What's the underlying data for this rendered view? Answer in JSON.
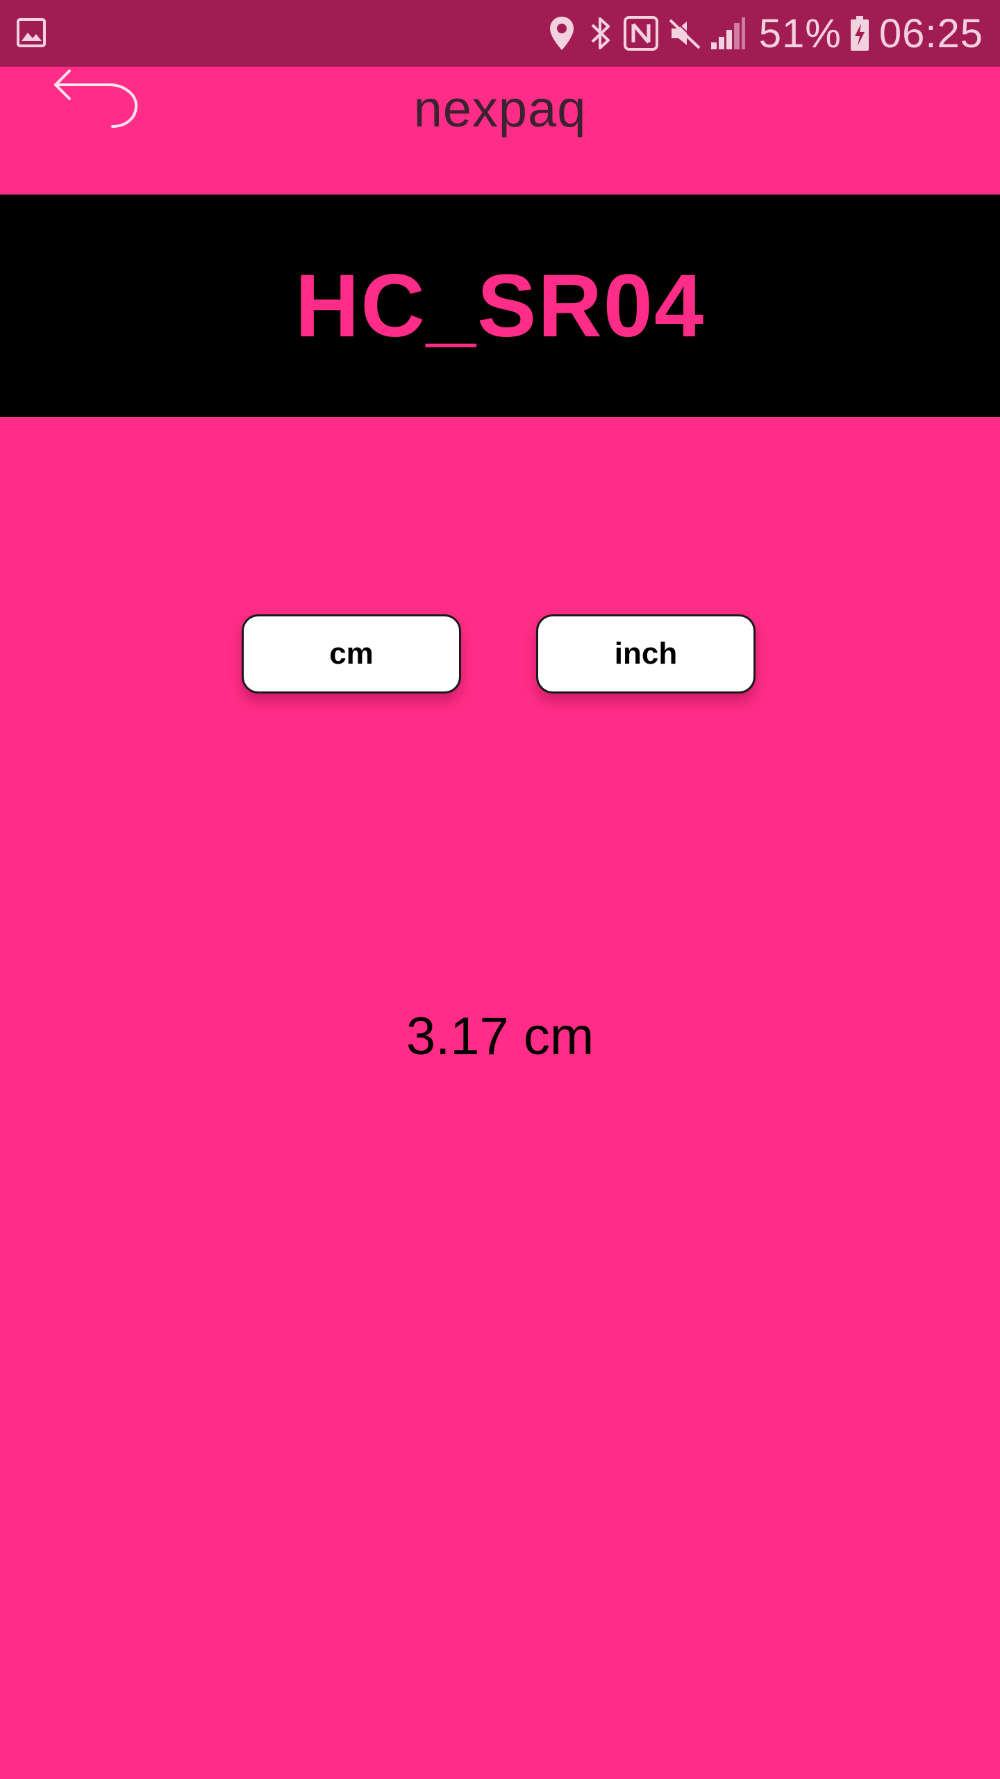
{
  "status_bar": {
    "icons": [
      "gallery-icon",
      "location-icon",
      "bluetooth-icon",
      "nfc-icon",
      "mute-icon",
      "signal-icon",
      "battery-charging-icon"
    ],
    "battery_percent": "51%",
    "time": "06:25"
  },
  "toolbar": {
    "back_icon": "back-arrow-icon",
    "title": "nexpaq"
  },
  "sensor": {
    "name": "HC_SR04"
  },
  "units": {
    "cm_label": "cm",
    "inch_label": "inch"
  },
  "reading": {
    "value": "3.17 cm"
  },
  "colors": {
    "background": "#FF2D87",
    "status_bar": "#A21C54",
    "banner": "#000000",
    "title_text": "#3A2230",
    "button_bg": "#FFFFFF"
  }
}
